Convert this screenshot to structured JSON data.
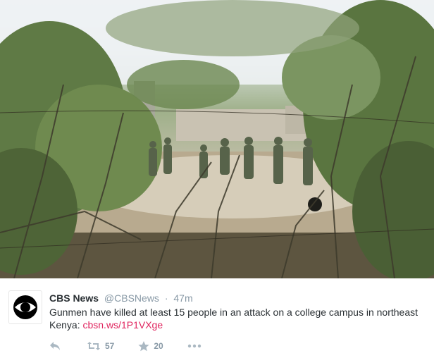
{
  "tweet": {
    "display_name": "CBS News",
    "handle": "@CBSNews",
    "separator": "·",
    "timestamp": "47m",
    "text": "Gunmen have killed at least 15 people in an attack on a college campus in northeast Kenya: ",
    "link_text": "cbsn.ws/1P1VXge",
    "retweet_count": "57",
    "favorite_count": "20"
  },
  "icons": {
    "avatar": "cbs-eye-logo",
    "reply": "reply-icon",
    "retweet": "retweet-icon",
    "favorite": "star-icon",
    "more": "more-dots-icon"
  },
  "colors": {
    "name": "#292f33",
    "meta": "#8899a6",
    "link": "#e0245e",
    "icon": "#aab8c2"
  }
}
